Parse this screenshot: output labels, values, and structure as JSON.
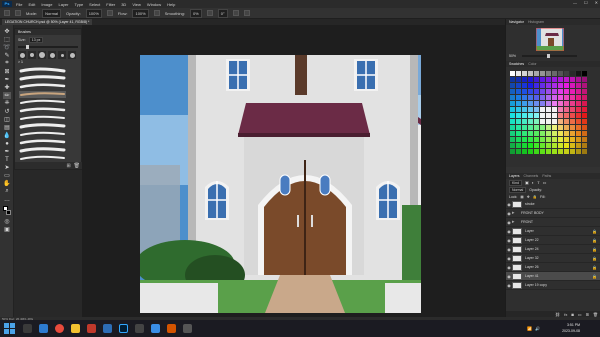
{
  "menubar": {
    "items": [
      "File",
      "Edit",
      "Image",
      "Layer",
      "Type",
      "Select",
      "Filter",
      "3D",
      "View",
      "Window",
      "Help"
    ]
  },
  "window_controls": {
    "minimize": "—",
    "maximize": "☐",
    "close": "✕"
  },
  "options": {
    "mode_label": "Mode:",
    "mode_value": "Normal",
    "opacity_label": "Opacity:",
    "opacity_value": "100%",
    "flow_label": "Flow:",
    "flow_value": "100%",
    "smoothing_label": "Smoothing:",
    "smoothing_value": "0%",
    "angle": "0°"
  },
  "doc_tab": {
    "title": "LEGATION CHURCH.psd @ 50% (Layer 41, RGB/8) *"
  },
  "brushes": {
    "panel_title": "Brushes",
    "size_label": "Size:",
    "size_value": "13 px",
    "group_name": "> 1"
  },
  "navigator": {
    "tabs": [
      "Navigator",
      "Histogram"
    ],
    "zoom": "50%"
  },
  "swatches": {
    "tabs": [
      "Swatches",
      "Color"
    ]
  },
  "layers_panel": {
    "tabs": [
      "Layers",
      "Channels",
      "Paths"
    ],
    "kind_label": "Kind",
    "blend": "Normal",
    "opacity_label": "Opacity:",
    "lock_label": "Lock:",
    "fill_label": "Fill:",
    "rows": [
      {
        "name": "stroke",
        "type": "layer",
        "visible": true,
        "active": false,
        "locked": false
      },
      {
        "name": "FRONT BODY",
        "type": "group",
        "visible": true,
        "active": false,
        "locked": false
      },
      {
        "name": "FRONT",
        "type": "group",
        "visible": true,
        "active": false,
        "locked": false
      },
      {
        "name": "Layer",
        "type": "layer",
        "visible": true,
        "active": false,
        "locked": true
      },
      {
        "name": "Layer 22",
        "type": "layer",
        "visible": true,
        "active": false,
        "locked": true
      },
      {
        "name": "Layer 24",
        "type": "layer",
        "visible": true,
        "active": false,
        "locked": true
      },
      {
        "name": "Layer 32",
        "type": "layer",
        "visible": true,
        "active": false,
        "locked": true
      },
      {
        "name": "Layer 26",
        "type": "layer",
        "visible": true,
        "active": false,
        "locked": true
      },
      {
        "name": "Layer 41",
        "type": "layer",
        "visible": true,
        "active": true,
        "locked": true
      },
      {
        "name": "Layer 19 copy",
        "type": "layer",
        "visible": true,
        "active": false,
        "locked": false
      }
    ]
  },
  "status": {
    "text": "50%    Doc: 26.4M/1.48G"
  },
  "taskbar": {
    "time": "3:51 PM",
    "date": "2023-09-08"
  },
  "colors": {
    "accent": "#31a8ff",
    "sky": "#4d8fcc",
    "roof": "#6b2b46",
    "door": "#7a4a2a",
    "wall": "#e2e2e2"
  }
}
